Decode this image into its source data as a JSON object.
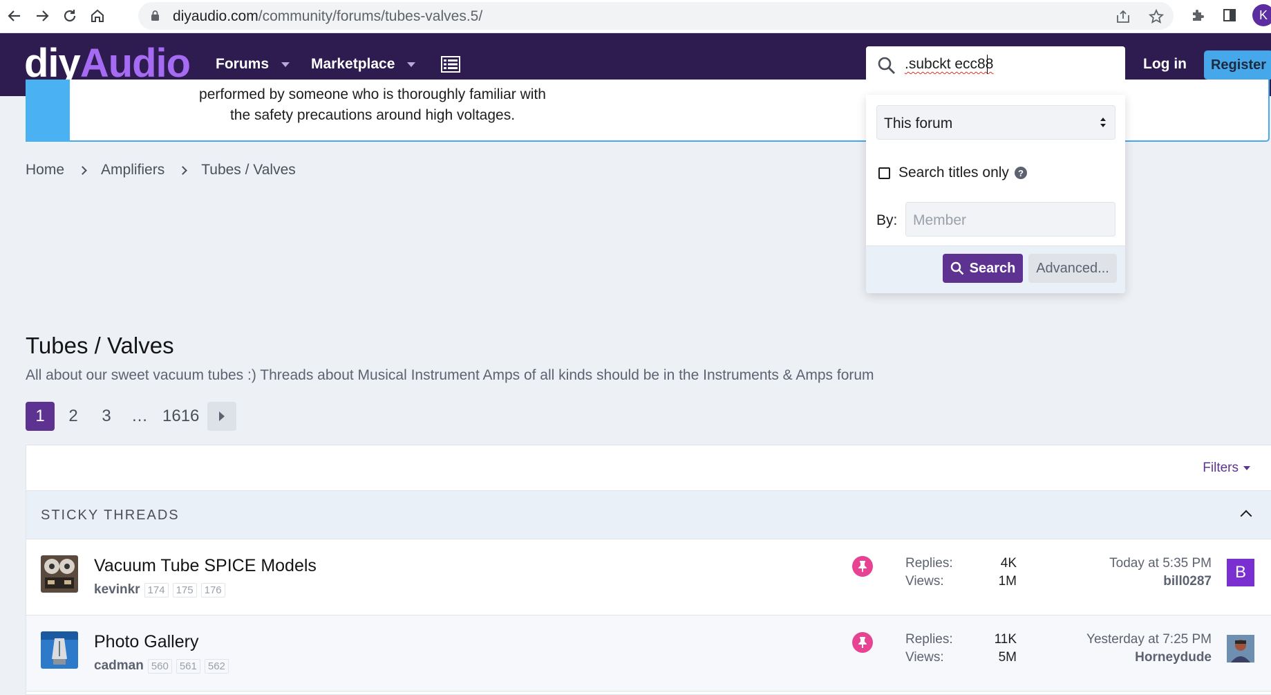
{
  "browser": {
    "url_host": "diyaudio.com",
    "url_path": "/community/forums/tubes-valves.5/",
    "profile_initial": "K"
  },
  "header": {
    "logo_part1": "diy",
    "logo_part2": "Audio",
    "nav": [
      "Forums",
      "Marketplace"
    ],
    "search_value": ".subckt ecc88",
    "login": "Log in",
    "register": "Register"
  },
  "notice": {
    "line1": "performed by someone who is thoroughly familiar with",
    "line2": "the safety precautions around high voltages."
  },
  "breadcrumb": [
    "Home",
    "Amplifiers",
    "Tubes / Valves"
  ],
  "page": {
    "title": "Tubes / Valves",
    "description": "All about our sweet vacuum tubes :) Threads about Musical Instrument Amps of all kinds should be in the Instruments & Amps forum"
  },
  "pagination": {
    "pages": [
      "1",
      "2",
      "3",
      "…",
      "1616"
    ],
    "current": "1"
  },
  "threadlist": {
    "filters": "Filters",
    "sticky_label": "STICKY THREADS",
    "replies_label": "Replies:",
    "views_label": "Views:",
    "threads": [
      {
        "title": "Vacuum Tube SPICE Models",
        "author": "kevinkr",
        "pages": [
          "174",
          "175",
          "176"
        ],
        "replies": "4K",
        "views": "1M",
        "latest_when": "Today at 5:35 PM",
        "latest_user": "bill0287",
        "avatar_letter": "B"
      },
      {
        "title": "Photo Gallery",
        "author": "cadman",
        "pages": [
          "560",
          "561",
          "562"
        ],
        "replies": "11K",
        "views": "5M",
        "latest_when": "Yesterday at 7:25 PM",
        "latest_user": "Horneydude",
        "avatar_letter": ""
      }
    ]
  },
  "search_menu": {
    "scope": "This forum",
    "titles_only": "Search titles only",
    "by_label": "By:",
    "member_placeholder": "Member",
    "search_button": "Search",
    "advanced_button": "Advanced..."
  }
}
